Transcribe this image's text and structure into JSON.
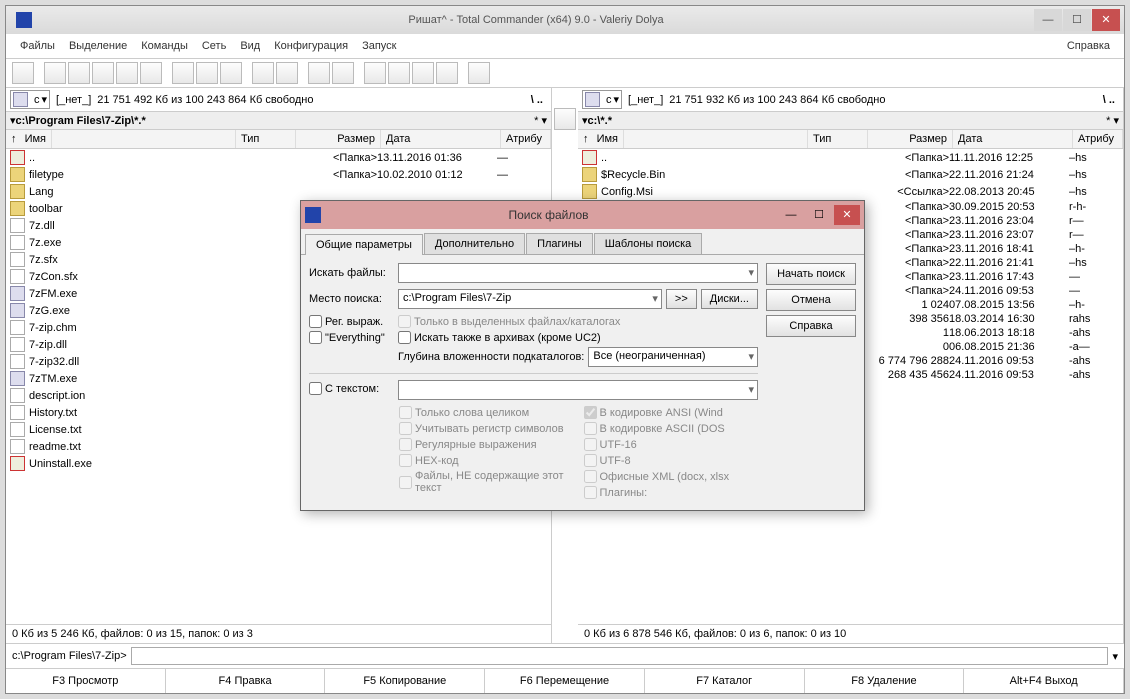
{
  "title": "Ришат^ - Total Commander (x64) 9.0 - Valeriy Dolya",
  "menu": [
    "Файлы",
    "Выделение",
    "Команды",
    "Сеть",
    "Вид",
    "Конфигурация",
    "Запуск"
  ],
  "menu_help": "Справка",
  "left": {
    "drive": "c",
    "drive_label": "[_нет_]",
    "space": "21 751 492 Кб из 100 243 864 Кб свободно",
    "path_symbols": "\\  ..",
    "path": "c:\\Program Files\\7-Zip\\*.*",
    "path_tail": "*  ▾",
    "cols": {
      "name": "Имя",
      "type": "Тип",
      "size": "Размер",
      "date": "Дата",
      "attr": "Атрибу"
    },
    "files": [
      {
        "ico": "u",
        "nm": "..",
        "sz": "<Папка>",
        "dt": "13.11.2016 01:36",
        "at": "—"
      },
      {
        "ico": "d",
        "nm": "filetype",
        "sz": "<Папка>",
        "dt": "10.02.2010 01:12",
        "at": "—"
      },
      {
        "ico": "d",
        "nm": "Lang"
      },
      {
        "ico": "d",
        "nm": "toolbar"
      },
      {
        "ico": "f",
        "nm": "7z.dll"
      },
      {
        "ico": "f",
        "nm": "7z.exe"
      },
      {
        "ico": "f",
        "nm": "7z.sfx"
      },
      {
        "ico": "f",
        "nm": "7zCon.sfx"
      },
      {
        "ico": "e",
        "nm": "7zFM.exe"
      },
      {
        "ico": "e",
        "nm": "7zG.exe"
      },
      {
        "ico": "f",
        "nm": "7-zip.chm"
      },
      {
        "ico": "f",
        "nm": "7-zip.dll"
      },
      {
        "ico": "f",
        "nm": "7-zip32.dll"
      },
      {
        "ico": "e",
        "nm": "7zTM.exe"
      },
      {
        "ico": "f",
        "nm": "descript.ion"
      },
      {
        "ico": "f",
        "nm": "History.txt"
      },
      {
        "ico": "f",
        "nm": "License.txt"
      },
      {
        "ico": "f",
        "nm": "readme.txt"
      },
      {
        "ico": "u",
        "nm": "Uninstall.exe"
      }
    ],
    "status": "0 Кб из 5 246 Кб, файлов: 0 из 15, папок: 0 из 3"
  },
  "right": {
    "drive": "c",
    "drive_label": "[_нет_]",
    "space": "21 751 932 Кб из 100 243 864 Кб свободно",
    "path_symbols": "\\  ..",
    "path": "c:\\*.*",
    "path_tail": "*  ▾",
    "cols": {
      "name": "Имя",
      "type": "Тип",
      "size": "Размер",
      "date": "Дата",
      "attr": "Атрибу"
    },
    "files": [
      {
        "ico": "u",
        "nm": "..",
        "sz": "<Папка>",
        "dt": "11.11.2016 12:25",
        "at": "–hs"
      },
      {
        "ico": "d",
        "nm": "$Recycle.Bin",
        "sz": "<Папка>",
        "dt": "22.11.2016 21:24",
        "at": "–hs"
      },
      {
        "ico": "d",
        "nm": "Config.Msi",
        "sz": "<Ссылка>",
        "dt": "22.08.2013 20:45",
        "at": "–hs"
      },
      {
        "sz": "<Папка>",
        "dt": "30.09.2015 20:53",
        "at": "r-h-"
      },
      {
        "sz": "<Папка>",
        "dt": "23.11.2016 23:04",
        "at": "r—"
      },
      {
        "sz": "<Папка>",
        "dt": "23.11.2016 23:07",
        "at": "r—"
      },
      {
        "sz": "<Папка>",
        "dt": "23.11.2016 18:41",
        "at": "–h-"
      },
      {
        "sz": "<Папка>",
        "dt": "22.11.2016 21:41",
        "at": "–hs"
      },
      {
        "sz": "<Папка>",
        "dt": "23.11.2016 17:43",
        "at": "—"
      },
      {
        "sz": "<Папка>",
        "dt": "24.11.2016 09:53",
        "at": "—"
      },
      {
        "sz": "1 024",
        "dt": "07.08.2015 13:56",
        "at": "–h-"
      },
      {
        "sz": "398 356",
        "dt": "18.03.2014 16:30",
        "at": "rahs"
      },
      {
        "sz": "1",
        "dt": "18.06.2013 18:18",
        "at": "-ahs"
      },
      {
        "sz": "0",
        "dt": "06.08.2015 21:36",
        "at": "-a—"
      },
      {
        "sz": "6 774 796 288",
        "dt": "24.11.2016 09:53",
        "at": "-ahs"
      },
      {
        "sz": "268 435 456",
        "dt": "24.11.2016 09:53",
        "at": "-ahs"
      }
    ],
    "status": "0 Кб из 6 878 546 Кб, файлов: 0 из 6, папок: 0 из 10"
  },
  "cmdline_prompt": "c:\\Program Files\\7-Zip>",
  "fkeys": [
    "F3 Просмотр",
    "F4 Правка",
    "F5 Копирование",
    "F6 Перемещение",
    "F7 Каталог",
    "F8 Удаление",
    "Alt+F4 Выход"
  ],
  "dialog": {
    "title": "Поиск файлов",
    "tabs": [
      "Общие параметры",
      "Дополнительно",
      "Плагины",
      "Шаблоны поиска"
    ],
    "lbl_search": "Искать файлы:",
    "lbl_place": "Место поиска:",
    "val_place": "c:\\Program Files\\7-Zip",
    "btn_goto": ">>",
    "btn_drives": "Диски...",
    "ck_regex": "Рег. выраж.",
    "ck_everything": "\"Everything\"",
    "ck_selected": "Только в выделенных файлах/каталогах",
    "ck_archives": "Искать также в архивах (кроме UC2)",
    "lbl_depth": "Глубина вложенности подкаталогов:",
    "val_depth": "Все (неограниченная)",
    "ck_withtext": "С текстом:",
    "opts_left": [
      "Только слова целиком",
      "Учитывать регистр символов",
      "Регулярные выражения",
      "HEX-код",
      "Файлы, НЕ содержащие этот текст"
    ],
    "opts_right": [
      "В кодировке ANSI (Wind",
      "В кодировке ASCII (DOS",
      "UTF-16",
      "UTF-8",
      "Офисные XML (docx, xlsx",
      "Плагины:"
    ],
    "ansi_checked": true,
    "btn_start": "Начать поиск",
    "btn_cancel": "Отмена",
    "btn_help": "Справка"
  }
}
